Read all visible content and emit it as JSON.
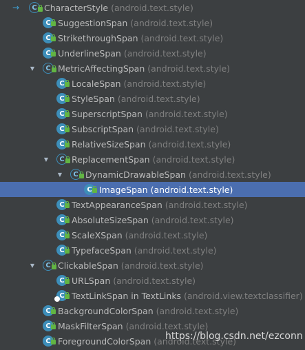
{
  "tree": [
    {
      "name": "CharacterStyle",
      "pkg": "(android.text.style)",
      "depth": 0,
      "arrow": "",
      "icon_type": "abstract",
      "root": true
    },
    {
      "name": "SuggestionSpan",
      "pkg": "(android.text.style)",
      "depth": 1,
      "arrow": "",
      "icon_type": "class"
    },
    {
      "name": "StrikethroughSpan",
      "pkg": "(android.text.style)",
      "depth": 1,
      "arrow": "",
      "icon_type": "class"
    },
    {
      "name": "UnderlineSpan",
      "pkg": "(android.text.style)",
      "depth": 1,
      "arrow": "",
      "icon_type": "class"
    },
    {
      "name": "MetricAffectingSpan",
      "pkg": "(android.text.style)",
      "depth": 1,
      "arrow": "expanded",
      "icon_type": "abstract"
    },
    {
      "name": "LocaleSpan",
      "pkg": "(android.text.style)",
      "depth": 2,
      "arrow": "",
      "icon_type": "class"
    },
    {
      "name": "StyleSpan",
      "pkg": "(android.text.style)",
      "depth": 2,
      "arrow": "",
      "icon_type": "class"
    },
    {
      "name": "SuperscriptSpan",
      "pkg": "(android.text.style)",
      "depth": 2,
      "arrow": "",
      "icon_type": "class"
    },
    {
      "name": "SubscriptSpan",
      "pkg": "(android.text.style)",
      "depth": 2,
      "arrow": "",
      "icon_type": "class"
    },
    {
      "name": "RelativeSizeSpan",
      "pkg": "(android.text.style)",
      "depth": 2,
      "arrow": "",
      "icon_type": "class"
    },
    {
      "name": "ReplacementSpan",
      "pkg": "(android.text.style)",
      "depth": 2,
      "arrow": "expanded",
      "icon_type": "abstract"
    },
    {
      "name": "DynamicDrawableSpan",
      "pkg": "(android.text.style)",
      "depth": 3,
      "arrow": "expanded",
      "icon_type": "abstract"
    },
    {
      "name": "ImageSpan",
      "pkg": "(android.text.style)",
      "depth": 4,
      "arrow": "",
      "icon_type": "class",
      "selected": true
    },
    {
      "name": "TextAppearanceSpan",
      "pkg": "(android.text.style)",
      "depth": 2,
      "arrow": "",
      "icon_type": "class"
    },
    {
      "name": "AbsoluteSizeSpan",
      "pkg": "(android.text.style)",
      "depth": 2,
      "arrow": "",
      "icon_type": "class"
    },
    {
      "name": "ScaleXSpan",
      "pkg": "(android.text.style)",
      "depth": 2,
      "arrow": "",
      "icon_type": "class"
    },
    {
      "name": "TypefaceSpan",
      "pkg": "(android.text.style)",
      "depth": 2,
      "arrow": "",
      "icon_type": "class"
    },
    {
      "name": "ClickableSpan",
      "pkg": "(android.text.style)",
      "depth": 1,
      "arrow": "expanded",
      "icon_type": "abstract"
    },
    {
      "name": "URLSpan",
      "pkg": "(android.text.style)",
      "depth": 2,
      "arrow": "",
      "icon_type": "class"
    },
    {
      "name": "TextLinkSpan in TextLinks",
      "pkg": "(android.view.textclassifier)",
      "depth": 2,
      "arrow": "",
      "icon_type": "class",
      "link": true
    },
    {
      "name": "BackgroundColorSpan",
      "pkg": "(android.text.style)",
      "depth": 1,
      "arrow": "",
      "icon_type": "class"
    },
    {
      "name": "MaskFilterSpan",
      "pkg": "(android.text.style)",
      "depth": 1,
      "arrow": "",
      "icon_type": "class"
    },
    {
      "name": "ForegroundColorSpan",
      "pkg": "(android.text.style)",
      "depth": 1,
      "arrow": "",
      "icon_type": "class"
    }
  ],
  "watermark": "https://blog.csdn.net/ezconn",
  "colors": {
    "background": "#3c3f41",
    "selection": "#4b6eaf",
    "class_icon": "#3d8eb9",
    "lock": "#62b543",
    "text": "#bbbbbb",
    "package_text": "#808080"
  }
}
